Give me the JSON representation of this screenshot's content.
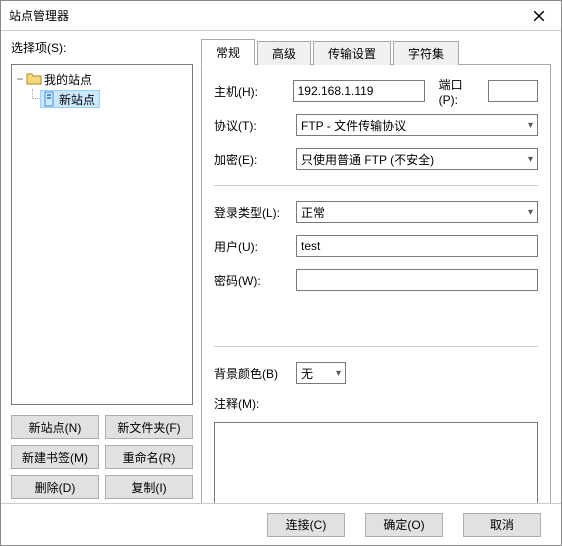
{
  "window": {
    "title": "站点管理器"
  },
  "left": {
    "select_label": "选择项(S):",
    "tree": {
      "root_label": "我的站点",
      "child_label": "新站点"
    },
    "buttons": {
      "new_site": "新站点(N)",
      "new_folder": "新文件夹(F)",
      "new_bookmark": "新建书签(M)",
      "rename": "重命名(R)",
      "delete": "删除(D)",
      "copy": "复制(I)"
    }
  },
  "tabs": {
    "general": "常规",
    "advanced": "高级",
    "transfer": "传输设置",
    "charset": "字符集"
  },
  "form": {
    "host_label": "主机(H):",
    "host_value": "192.168.1.119",
    "port_label": "端口(P):",
    "port_value": "",
    "protocol_label": "协议(T):",
    "protocol_value": "FTP - 文件传输协议",
    "encryption_label": "加密(E):",
    "encryption_value": "只使用普通 FTP (不安全)",
    "logon_label": "登录类型(L):",
    "logon_value": "正常",
    "user_label": "用户(U):",
    "user_value": "test",
    "password_label": "密码(W):",
    "password_value": "",
    "bgcolor_label": "背景颜色(B)",
    "bgcolor_value": "无",
    "comments_label": "注释(M):"
  },
  "bottom": {
    "connect": "连接(C)",
    "ok": "确定(O)",
    "cancel": "取消"
  }
}
